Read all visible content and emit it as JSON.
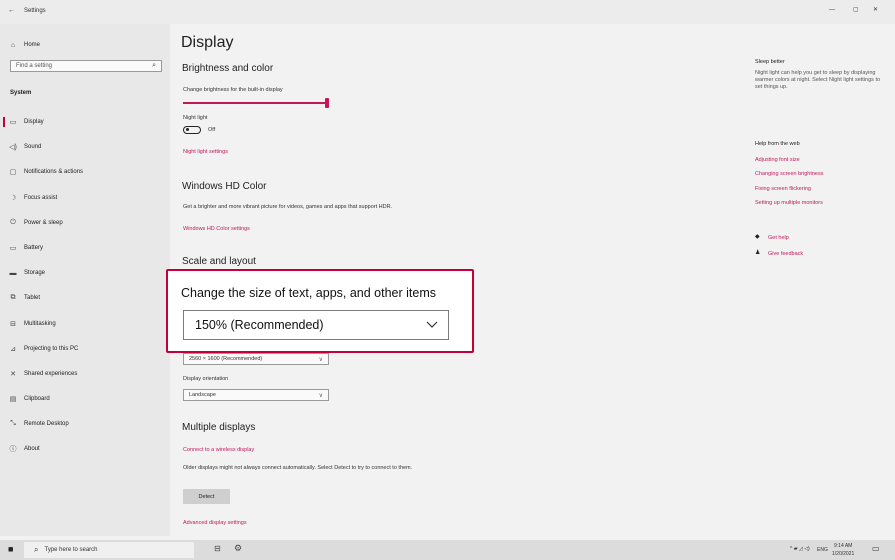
{
  "window": {
    "title": "Settings",
    "back_glyph": "←",
    "minimize_glyph": "—",
    "maximize_glyph": "▢",
    "close_glyph": "✕"
  },
  "sidebar": {
    "home_label": "Home",
    "search_placeholder": "Find a setting",
    "section_label": "System",
    "items": [
      {
        "label": "Display",
        "icon": "monitor-icon"
      },
      {
        "label": "Sound",
        "icon": "speaker-icon"
      },
      {
        "label": "Notifications & actions",
        "icon": "notification-icon"
      },
      {
        "label": "Focus assist",
        "icon": "moon-icon"
      },
      {
        "label": "Power & sleep",
        "icon": "power-icon"
      },
      {
        "label": "Battery",
        "icon": "battery-icon"
      },
      {
        "label": "Storage",
        "icon": "storage-icon"
      },
      {
        "label": "Tablet",
        "icon": "tablet-icon"
      },
      {
        "label": "Multitasking",
        "icon": "multitasking-icon"
      },
      {
        "label": "Projecting to this PC",
        "icon": "projecting-icon"
      },
      {
        "label": "Shared experiences",
        "icon": "shared-icon"
      },
      {
        "label": "Clipboard",
        "icon": "clipboard-icon"
      },
      {
        "label": "Remote Desktop",
        "icon": "remote-icon"
      },
      {
        "label": "About",
        "icon": "info-icon"
      }
    ]
  },
  "main": {
    "page_title": "Display",
    "brightness": {
      "heading": "Brightness and color",
      "slider_label": "Change brightness for the built-in display",
      "slider_value": 1.0,
      "night_light_label": "Night light",
      "night_light_state": "Off",
      "night_light_link": "Night light settings"
    },
    "hd_color": {
      "heading": "Windows HD Color",
      "description": "Get a brighter and more vibrant picture for videos, games and apps that support HDR.",
      "link": "Windows HD Color settings"
    },
    "scale": {
      "heading": "Scale and layout",
      "resolution_value": "2560 × 1600 (Recommended)",
      "orientation_label": "Display orientation",
      "orientation_value": "Landscape"
    },
    "multiple": {
      "heading": "Multiple displays",
      "connect_link": "Connect to a wireless display",
      "description": "Older displays might not always connect automatically. Select Detect to try to connect to them.",
      "detect_button": "Detect",
      "advanced_link": "Advanced display settings"
    }
  },
  "callout": {
    "title": "Change the size of text, apps, and other items",
    "selected_value": "150% (Recommended)",
    "border_color": "#c4003b"
  },
  "right_panel": {
    "sleep_heading": "Sleep better",
    "sleep_text": "Night light can help you get to sleep by displaying warmer colors at night. Select Night light settings to set things up.",
    "help_heading": "Help from the web",
    "help_links": [
      "Adjusting font size",
      "Changing screen brightness",
      "Fixing screen flickering",
      "Setting up multiple monitors"
    ],
    "get_help": "Get help",
    "give_feedback": "Give feedback"
  },
  "taskbar": {
    "search_placeholder": "Type here to search",
    "lang": "ENG",
    "time": "9:14 AM",
    "date": "1/20/2021"
  },
  "colors": {
    "accent": "#c2185b"
  }
}
